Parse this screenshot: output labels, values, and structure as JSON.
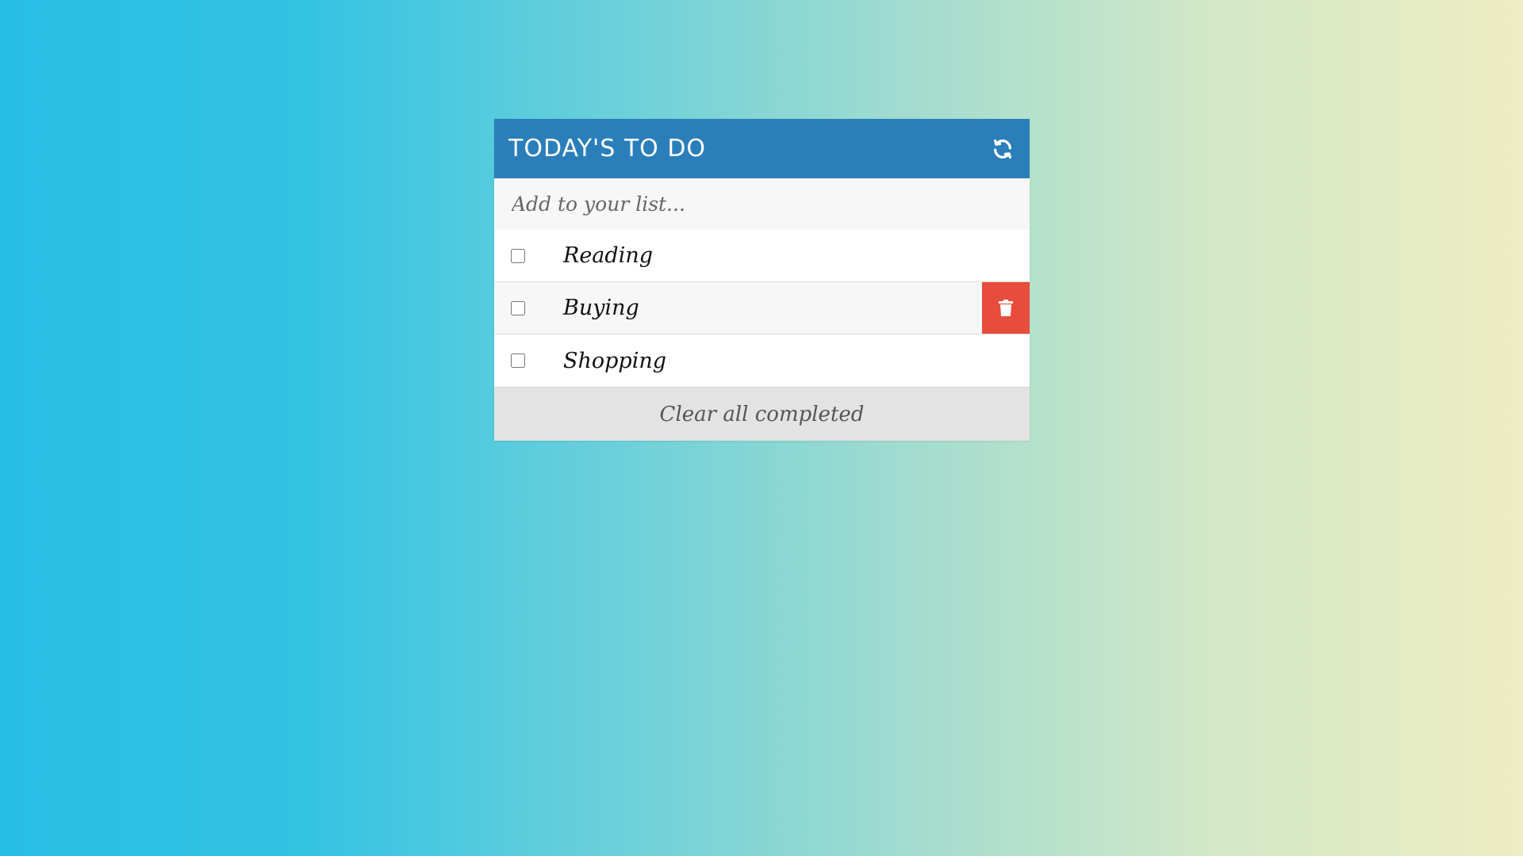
{
  "header": {
    "title": "TODAY'S TO DO",
    "refresh_icon": "refresh-icon"
  },
  "input": {
    "placeholder": "Add to your list...",
    "value": ""
  },
  "todos": [
    {
      "label": "Reading",
      "checked": false
    },
    {
      "label": "Buying",
      "checked": false,
      "hovered": true
    },
    {
      "label": "Shopping",
      "checked": false
    }
  ],
  "delete_icon": "trash-icon",
  "footer": {
    "clear_label": "Clear all completed"
  },
  "colors": {
    "header_bg": "#2a7fba",
    "delete_bg": "#e74c3c",
    "footer_bg": "#e3e3e3"
  }
}
